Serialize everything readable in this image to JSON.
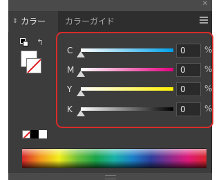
{
  "colors": {
    "panel_bg": "#3c3c3c",
    "highlight": "#d92b2b",
    "cyan": "#00a0e9",
    "magenta": "#e4007f",
    "yellow": "#fff100",
    "black": "#000000"
  },
  "tabs": [
    {
      "label": "カラー",
      "active": true
    },
    {
      "label": "カラーガイド",
      "active": false
    }
  ],
  "icons": {
    "tab_chevron": "chevron-up-down-icon",
    "menu": "panel-menu-icon",
    "default": "default-fill-stroke-icon",
    "swap": "swap-fill-stroke-icon"
  },
  "sliders": [
    {
      "label": "C",
      "value": 0,
      "unit": "%"
    },
    {
      "label": "M",
      "value": 0,
      "unit": "%"
    },
    {
      "label": "Y",
      "value": 0,
      "unit": "%"
    },
    {
      "label": "K",
      "value": 0,
      "unit": "%"
    }
  ]
}
